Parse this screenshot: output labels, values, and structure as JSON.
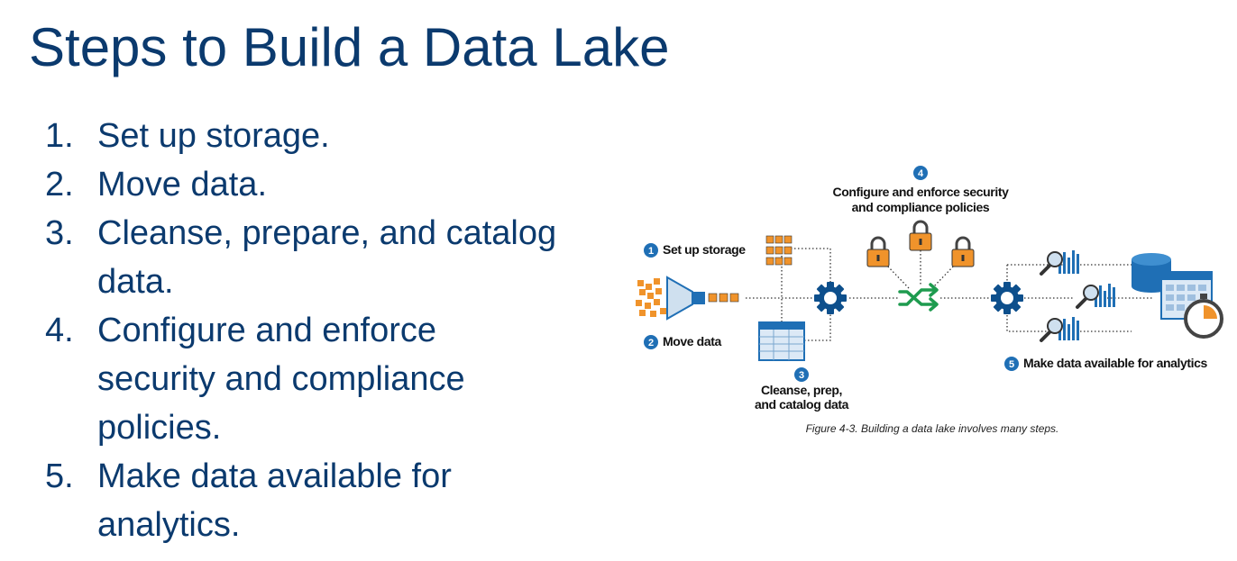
{
  "title": "Steps to Build a Data Lake",
  "steps": [
    {
      "num": "1.",
      "lines": [
        "Set up storage."
      ]
    },
    {
      "num": "2.",
      "lines": [
        "Move data."
      ]
    },
    {
      "num": "3.",
      "lines": [
        "Cleanse, prepare, and catalog",
        "data."
      ]
    },
    {
      "num": "4.",
      "lines": [
        "Configure and enforce",
        "security and compliance",
        "policies."
      ]
    },
    {
      "num": "5.",
      "lines": [
        "Make data available for",
        "analytics."
      ]
    }
  ],
  "diagram": {
    "badges": [
      "1",
      "2",
      "3",
      "4",
      "5"
    ],
    "labels": {
      "setup": "Set up storage",
      "move": "Move data",
      "cleanse_1": "Cleanse, prep,",
      "cleanse_2": "and catalog data",
      "configure_1": "Configure and enforce security",
      "configure_2": "and compliance policies",
      "available": "Make data available for analytics"
    },
    "caption": "Figure 4-3. Building a data lake involves many steps.",
    "colors": {
      "blue": "#1f6fb5",
      "dark_blue": "#0d4f8c",
      "orange": "#f0932b",
      "green": "#1e9b4f",
      "title": "#0b3a6e"
    },
    "icons": [
      "orange-grid-icon",
      "funnel-icon",
      "spreadsheet-icon",
      "gear-icon",
      "padlock-icon",
      "shuffle-arrows-icon",
      "magnifier-chart-icon",
      "database-icon",
      "calendar-icon",
      "stopwatch-icon"
    ]
  }
}
